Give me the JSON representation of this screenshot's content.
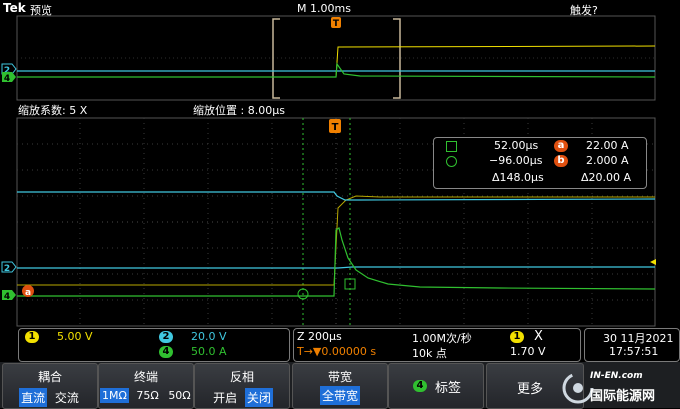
{
  "topbar": {
    "brand": "Tek",
    "mode": "预览",
    "timebase": "M 1.00ms",
    "trigger_status": "触发?"
  },
  "zoom": {
    "factor_label": "缩放系数: 5 X",
    "position_label": "缩放位置 :  8.00μs"
  },
  "markers": {
    "trigger": "T",
    "ch2": "2",
    "ch4": "4",
    "cursor_a": "a",
    "cursor_b": "b"
  },
  "cursor_readout": {
    "row1_time": "52.00μs",
    "row1_badge": "a",
    "row1_value": "22.00 A",
    "row2_time": "−96.00μs",
    "row2_badge": "b",
    "row2_value": "2.000 A",
    "row3_delta_time": "Δ148.0μs",
    "row3_delta_value": "Δ20.00 A"
  },
  "channels": [
    {
      "num": "1",
      "scale": "5.00 V",
      "color": "#f2e000"
    },
    {
      "num": "2",
      "scale": "20.0 V",
      "color": "#40c8e0"
    },
    {
      "num": "4",
      "scale": "50.0 A",
      "color": "#30c030"
    }
  ],
  "acquisition": {
    "zoom_time": "Z 200μs",
    "trigger_pos": "T→▼0.00000 s",
    "rate": "1.00M次/秒",
    "points": "10k 点",
    "trig_ch": "1",
    "trig_symbol": "X",
    "trig_level": "1.70 V"
  },
  "datetime": {
    "date": "30 11月2021",
    "time": "17:57:51"
  },
  "menu": {
    "coupling": {
      "title": "耦合",
      "opts": [
        "直流",
        "交流"
      ],
      "selected": 0
    },
    "termination": {
      "title": "终端",
      "opts": [
        "1MΩ",
        "75Ω",
        "50Ω"
      ],
      "selected": 0
    },
    "invert": {
      "title": "反相",
      "opts": [
        "开启",
        "关闭"
      ],
      "selected": 1
    },
    "bandwidth": {
      "title": "带宽",
      "opts": [
        "全带宽"
      ],
      "selected": 0
    },
    "label": {
      "badge": "4",
      "title": "标签"
    },
    "more": {
      "title": "更多"
    }
  },
  "watermark": {
    "line1": "IN-EN.com",
    "line2": "国际能源网"
  },
  "colors": {
    "ch1": "#f2e000",
    "ch2": "#40c8e0",
    "ch4": "#30c030",
    "trigger": "#f08000",
    "cursor": "#e05010",
    "grid": "#3a3a3a"
  }
}
